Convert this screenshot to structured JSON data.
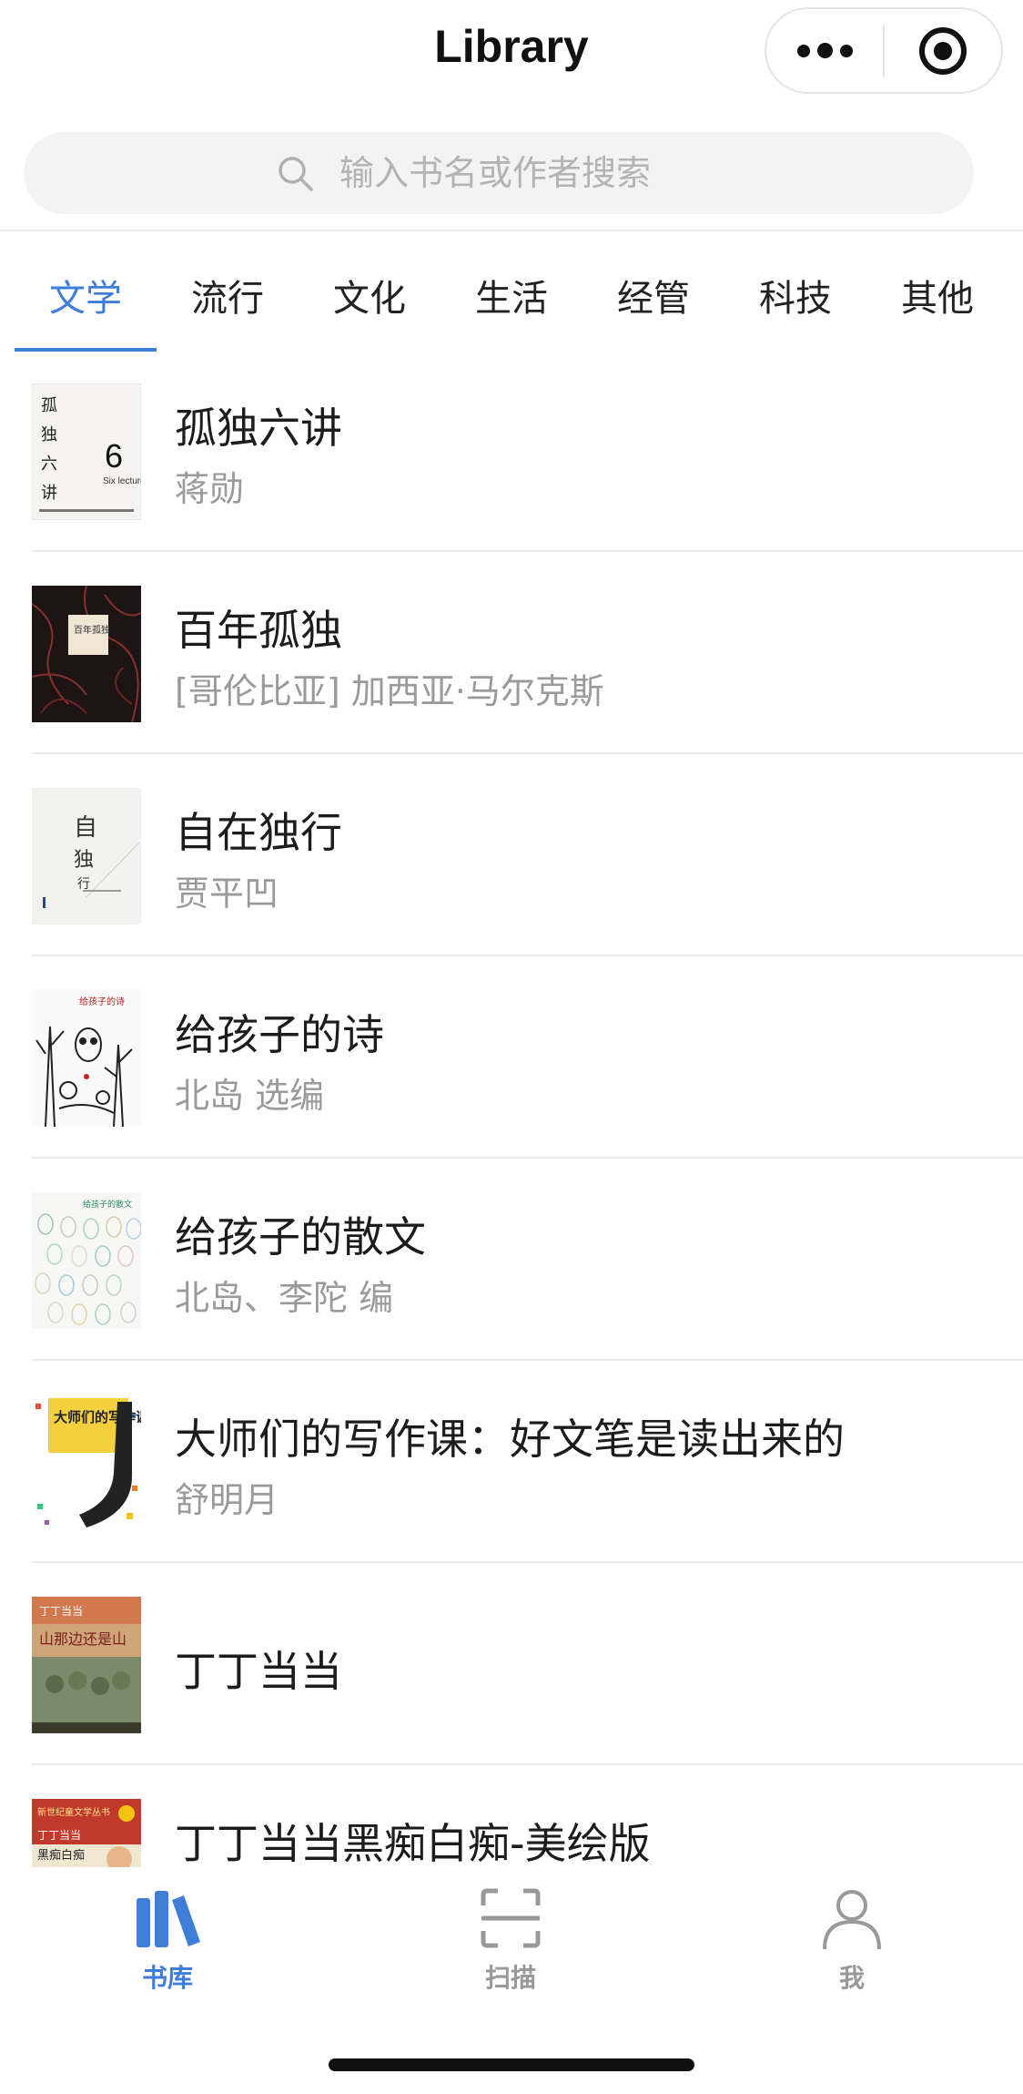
{
  "header": {
    "title": "Library"
  },
  "search": {
    "placeholder": "输入书名或作者搜索"
  },
  "tabs": [
    {
      "label": "文学",
      "active": true
    },
    {
      "label": "流行"
    },
    {
      "label": "文化"
    },
    {
      "label": "生活"
    },
    {
      "label": "经管"
    },
    {
      "label": "科技"
    },
    {
      "label": "其他"
    }
  ],
  "books": [
    {
      "title": "孤独六讲",
      "author": "蒋勋",
      "cover_text": "6",
      "cover_text_small": "Six lectures"
    },
    {
      "title": "百年孤独",
      "author": "[哥伦比亚] 加西亚·马尔克斯"
    },
    {
      "title": "自在独行",
      "author": "贾平凹"
    },
    {
      "title": "给孩子的诗",
      "author": "北岛 选编"
    },
    {
      "title": "给孩子的散文",
      "author": "北岛、李陀 编"
    },
    {
      "title": "大师们的写作课：好文笔是读出来的",
      "author": "舒明月",
      "cover_text": "大师们的写作课"
    },
    {
      "title": "丁丁当当",
      "author": ""
    },
    {
      "title": "丁丁当当黑痴白痴-美绘版",
      "author": ""
    }
  ],
  "tabbar": {
    "items": [
      {
        "label": "书库",
        "active": true
      },
      {
        "label": "扫描"
      },
      {
        "label": "我"
      }
    ]
  },
  "colors": {
    "accent": "#3f7ed8",
    "muted": "#9a9a9a"
  }
}
